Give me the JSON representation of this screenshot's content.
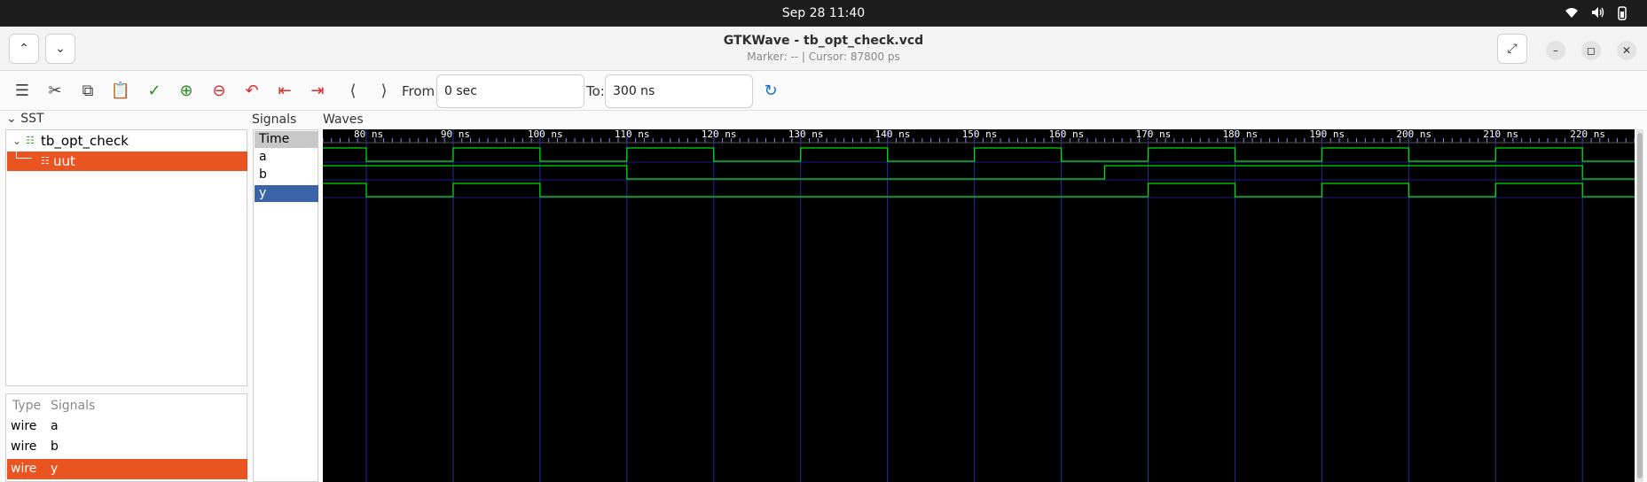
{
  "topbar": {
    "datetime": "Sep 28  11:40"
  },
  "window": {
    "title": "GTKWave - tb_opt_check.vcd",
    "subtitle": "Marker: --  |  Cursor: 87800 ps"
  },
  "toolbar": {
    "from_label": "From:",
    "from_value": "0 sec",
    "to_label": "To:",
    "to_value": "300 ns",
    "icons": [
      "menu-icon",
      "cut-icon",
      "copy-icon",
      "paste-icon",
      "select-all-icon",
      "zoom-in-icon",
      "zoom-out-icon",
      "undo-zoom-icon",
      "zoom-to-start-icon",
      "zoom-to-end-icon",
      "previous-edge-icon",
      "next-edge-icon",
      "reload-icon"
    ]
  },
  "sst": {
    "label": "SST",
    "tree": [
      {
        "label": "tb_opt_check",
        "expanded": true
      },
      {
        "label": "uut",
        "selected": true
      }
    ],
    "list_headers": {
      "type": "Type",
      "signals": "Signals"
    },
    "list": [
      {
        "type": "wire",
        "name": "a"
      },
      {
        "type": "wire",
        "name": "b"
      },
      {
        "type": "wire",
        "name": "y",
        "selected": true
      }
    ]
  },
  "signals": {
    "label": "Signals",
    "rows": [
      {
        "name": "Time",
        "header": true
      },
      {
        "name": "a"
      },
      {
        "name": "b"
      },
      {
        "name": "y",
        "selected": true
      }
    ]
  },
  "waves": {
    "label": "Waves",
    "time_unit": "ns",
    "tick_labels": [
      "80 ns",
      "90 ns",
      "100 ns",
      "110 ns",
      "120 ns",
      "130 ns",
      "140 ns",
      "150 ns",
      "160 ns",
      "170 ns",
      "180 ns",
      "190 ns",
      "200 ns",
      "210 ns",
      "220 ns"
    ],
    "tick_times": [
      80,
      90,
      100,
      110,
      120,
      130,
      140,
      150,
      160,
      170,
      180,
      190,
      200,
      210,
      220
    ],
    "view_start": 75,
    "view_end": 226,
    "gridlines": [
      80,
      90,
      100,
      110,
      120,
      130,
      140,
      150,
      160,
      170,
      180,
      190,
      200,
      210,
      220
    ],
    "signals": [
      {
        "name": "a",
        "init": 1,
        "edges": [
          80,
          90,
          100,
          110,
          120,
          130,
          140,
          150,
          160,
          170,
          180,
          190,
          200,
          210,
          220
        ]
      },
      {
        "name": "b",
        "init": 1,
        "edges": [
          110,
          165,
          220
        ]
      },
      {
        "name": "y",
        "init": 1,
        "edges": [
          80,
          90,
          100,
          170,
          180,
          190,
          200,
          210,
          220
        ]
      }
    ],
    "colors": {
      "background": "#000000",
      "trace": "#00e000",
      "grid": "#2a2a9a",
      "tick_text": "#ffffff",
      "selection": "#e95420",
      "selected_row": "#3b63a8"
    }
  }
}
